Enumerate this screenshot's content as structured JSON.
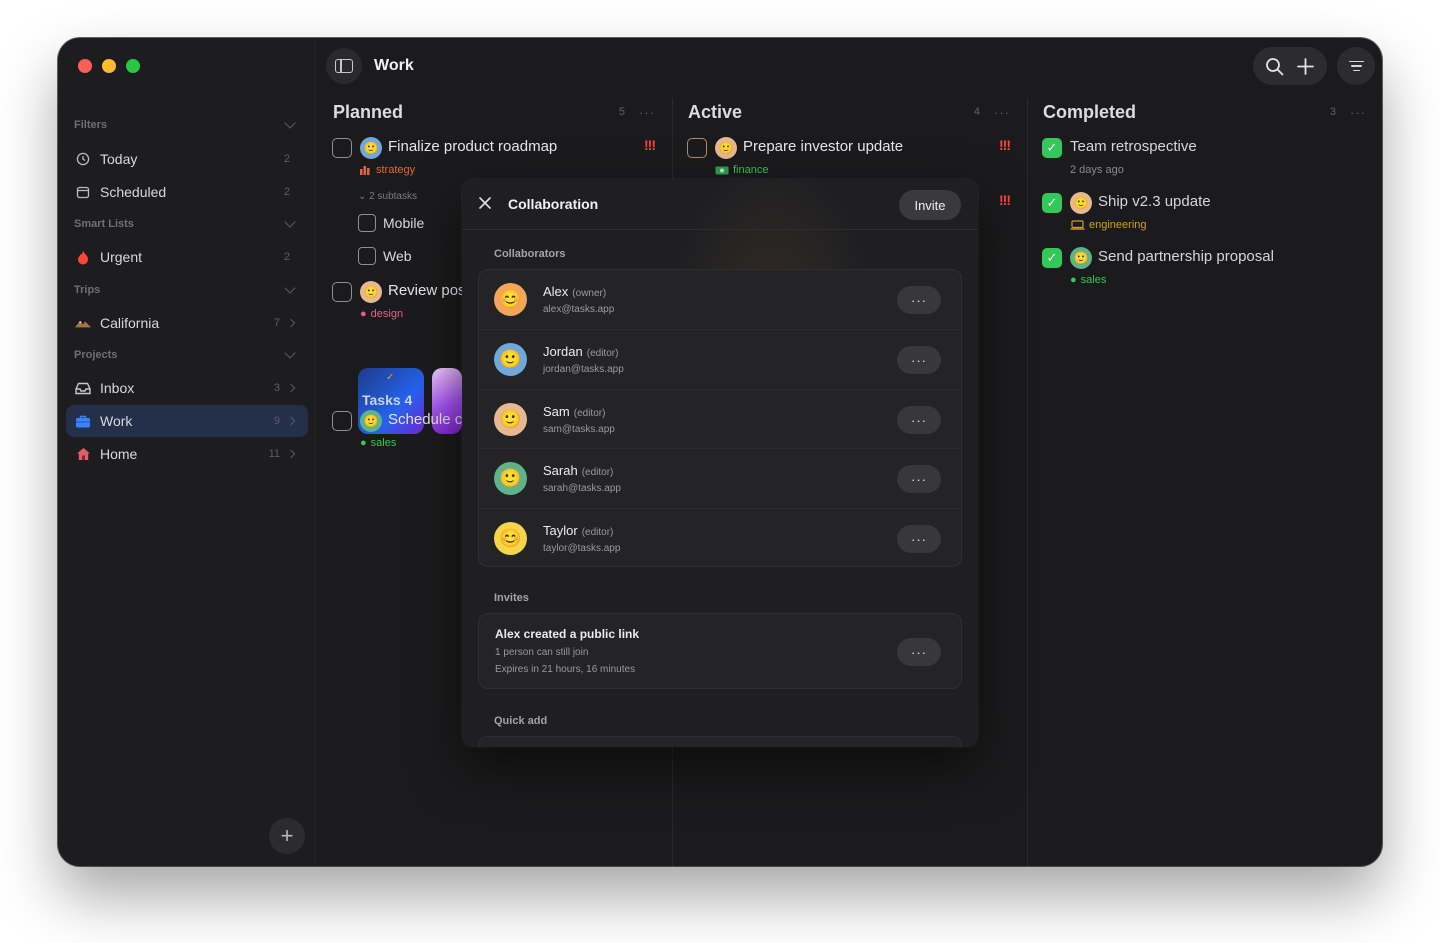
{
  "window": {
    "title": "Work"
  },
  "sidebar": {
    "sections": {
      "filters": "Filters",
      "smart_lists": "Smart Lists",
      "trips": "Trips",
      "projects": "Projects"
    },
    "items": [
      {
        "label": "Today",
        "count": "2",
        "icon": "clock-icon"
      },
      {
        "label": "Scheduled",
        "count": "2",
        "icon": "calendar-icon"
      },
      {
        "label": "Urgent",
        "count": "2",
        "icon": "flame-icon"
      },
      {
        "label": "California",
        "count": "7",
        "icon": "mountain-icon"
      },
      {
        "label": "Inbox",
        "count": "3",
        "icon": "inbox-icon"
      },
      {
        "label": "Work",
        "count": "9",
        "icon": "briefcase-icon",
        "active": true
      },
      {
        "label": "Home",
        "count": "11",
        "icon": "house-icon"
      }
    ]
  },
  "columns": [
    {
      "name": "Planned",
      "count": "5",
      "tasks": [
        {
          "title": "Finalize product roadmap",
          "tag": "strategy",
          "tag_color": "#e0683a",
          "priority": "!!!",
          "subtasks_label": "2 subtasks",
          "subtasks": [
            "Mobile",
            "Web"
          ]
        },
        {
          "title": "Review pos",
          "tag": "design",
          "tag_color": "#e0608a",
          "thumb_text": "Tasks 4"
        },
        {
          "title": "Schedule c",
          "tag": "sales",
          "tag_color": "#34c759"
        }
      ]
    },
    {
      "name": "Active",
      "count": "4",
      "tasks": [
        {
          "title": "Prepare investor update",
          "tag": "finance",
          "tag_color": "#34c759",
          "priority": "!!!"
        },
        {
          "priority": "!!!"
        }
      ]
    },
    {
      "name": "Completed",
      "count": "3",
      "tasks": [
        {
          "title": "Team retrospective",
          "meta": "2 days ago"
        },
        {
          "title": "Ship v2.3 update",
          "tag": "engineering",
          "tag_color": "#d4a017"
        },
        {
          "title": "Send partnership proposal",
          "tag": "sales",
          "tag_color": "#34c759"
        }
      ]
    }
  ],
  "modal": {
    "title": "Collaboration",
    "invite_label": "Invite",
    "collaborators_heading": "Collaborators",
    "collaborators": [
      {
        "name": "Alex",
        "role": "(owner)",
        "email": "alex@tasks.app",
        "avatar_bg": "#f2a65a",
        "avatar": "😊"
      },
      {
        "name": "Jordan",
        "role": "(editor)",
        "email": "jordan@tasks.app",
        "avatar_bg": "#6fa8dc",
        "avatar": "🙂"
      },
      {
        "name": "Sam",
        "role": "(editor)",
        "email": "sam@tasks.app",
        "avatar_bg": "#e6b894",
        "avatar": "🙂"
      },
      {
        "name": "Sarah",
        "role": "(editor)",
        "email": "sarah@tasks.app",
        "avatar_bg": "#5fb38a",
        "avatar": "🙂"
      },
      {
        "name": "Taylor",
        "role": "(editor)",
        "email": "taylor@tasks.app",
        "avatar_bg": "#f5d54a",
        "avatar": "😊"
      }
    ],
    "more_label": "···",
    "invites_heading": "Invites",
    "invite": {
      "title": "Alex created a public link",
      "line2": "1 person can still join",
      "line3": "Expires in 21 hours, 16 minutes"
    },
    "quick_add_heading": "Quick add"
  }
}
